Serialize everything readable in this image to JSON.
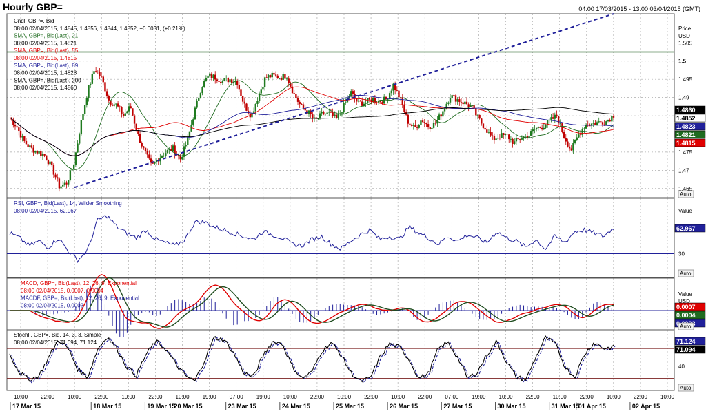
{
  "header": {
    "title": "Hourly GBP=",
    "range": "04:00 17/03/2015 - 13:00 03/04/2015 (GMT)"
  },
  "panels": {
    "price": {
      "unit_title": "Price",
      "unit_sub": "USD",
      "auto": "Auto",
      "legend": [
        {
          "text": "Cndl, GBP=, Bid",
          "color": "#000000"
        },
        {
          "text": "08:00 02/04/2015, 1.4845, 1.4856, 1.4844, 1.4852, +0.0031, (+0.21%)",
          "color": "#000000"
        },
        {
          "text": "SMA, GBP=, Bid(Last),  21",
          "color": "#1f6b1f"
        },
        {
          "text": "08:00 02/04/2015, 1.4821",
          "color": "#000000"
        },
        {
          "text": "SMA, GBP=, Bid(Last),  55",
          "color": "#e00000"
        },
        {
          "text": "08:00 02/04/2015, 1.4815",
          "color": "#e00000"
        },
        {
          "text": "SMA, GBP=, Bid(Last),  89",
          "color": "#20209a"
        },
        {
          "text": "08:00 02/04/2015, 1.4823",
          "color": "#000000"
        },
        {
          "text": "SMA, GBP=, Bid(Last),  200",
          "color": "#000000"
        },
        {
          "text": "08:00 02/04/2015, 1.4860",
          "color": "#000000"
        }
      ],
      "ticks": [
        "1.505",
        "1.5",
        "1.495",
        "1.49",
        "1.485",
        "1.48",
        "1.475",
        "1.47",
        "1.465"
      ],
      "tags": [
        {
          "text": "1.4860",
          "bg": "#000000",
          "fg": "#ffffff"
        },
        {
          "text": "1.4852",
          "bg": "#ffffff",
          "fg": "#000000"
        },
        {
          "text": "1.4823",
          "bg": "#20209a",
          "fg": "#ffffff"
        },
        {
          "text": "1.4821",
          "bg": "#1f6b1f",
          "fg": "#ffffff"
        },
        {
          "text": "1.4815",
          "bg": "#e00000",
          "fg": "#ffffff"
        }
      ]
    },
    "rsi": {
      "unit_title": "Value",
      "auto": "Auto",
      "legend": [
        {
          "text": "RSI, GBP=, Bid(Last),  14,  Wilder Smoothing",
          "color": "#20209a"
        },
        {
          "text": "08:00 02/04/2015, 62.967",
          "color": "#20209a"
        }
      ],
      "ticks": [
        "30"
      ],
      "tags": [
        {
          "text": "62.967",
          "bg": "#20209a",
          "fg": "#ffffff"
        }
      ]
    },
    "macd": {
      "unit_title": "Value",
      "unit_sub": "USD",
      "auto": "Auto",
      "legend": [
        {
          "text": "MACD, GBP=, Bid(Last),  12, 26, 9, Exponential",
          "color": "#e00000"
        },
        {
          "text": "08:00 02/04/2015, 0.0007, 0.0004",
          "color": "#e00000"
        },
        {
          "text": "MACDF, GBP=, Bid(Last),  12, 26, 9, Exponential",
          "color": "#20209a"
        },
        {
          "text": "08:00 02/04/2015, 0.0003",
          "color": "#20209a"
        }
      ],
      "tags": [
        {
          "text": "0.0007",
          "bg": "#e00000",
          "fg": "#ffffff"
        },
        {
          "text": "0.0004",
          "bg": "#1f6b1f",
          "fg": "#ffffff"
        },
        {
          "text": "0.0003",
          "bg": "#20209a",
          "fg": "#ffffff"
        }
      ]
    },
    "stoch": {
      "auto": "Auto",
      "legend": [
        {
          "text": "StochF, GBP=, Bid,  14, 3, 3, Simple",
          "color": "#000000"
        },
        {
          "text": "08:00 02/04/2015, 71.094, 71.124",
          "color": "#000000"
        }
      ],
      "ticks": [
        "40"
      ],
      "tags": [
        {
          "text": "71.124",
          "bg": "#20209a",
          "fg": "#ffffff"
        },
        {
          "text": "71.094",
          "bg": "#000000",
          "fg": "#ffffff"
        }
      ]
    }
  },
  "x_axis": {
    "time_labels": [
      "10:00",
      "22:00",
      "10:00",
      "22:00",
      "10:00",
      "22:00",
      "10:00",
      "19:00",
      "07:00",
      "19:00",
      "10:00",
      "22:00",
      "10:00",
      "22:00",
      "10:00",
      "22:00",
      "07:00",
      "19:00",
      "10:00",
      "22:00",
      "10:00",
      "22:00",
      "10:00",
      "22:00",
      "10:00"
    ],
    "date_labels": [
      "17 Mar 15",
      "18 Mar 15",
      "19 Mar 15",
      "20 Mar 15",
      "23 Mar 15",
      "24 Mar 15",
      "25 Mar 15",
      "26 Mar 15",
      "27 Mar 15",
      "30 Mar 15",
      "31 Mar 15",
      "01 Apr 15",
      "02 Apr 15"
    ]
  },
  "colors": {
    "up": "#1f7a1f",
    "down": "#c00000",
    "sma21": "#1f6b1f",
    "sma55": "#e00000",
    "sma89": "#20209a",
    "sma200": "#000000",
    "rsi": "#20209a",
    "macd": "#e00000",
    "macd_signal": "#1f4d1f",
    "macd_hist": "#20209a",
    "stoch_k": "#000000",
    "stoch_d": "#20209a",
    "trend": "#20209a",
    "hline": "#1f5a1f"
  },
  "chart_data": [
    {
      "type": "candlestick",
      "title": "Hourly GBP=",
      "ylabel": "Price USD",
      "ylim": [
        1.4625,
        1.513
      ],
      "reference_line": 1.5025,
      "trendline": [
        {
          "date": "18 Mar 15 04:00",
          "value": 1.4653
        },
        {
          "date": "03 Apr 15 13:00",
          "value": 1.513
        }
      ],
      "last_candle": {
        "time": "08:00 02/04/2015",
        "open": 1.4845,
        "high": 1.4856,
        "low": 1.4844,
        "close": 1.4852,
        "change": 0.0031,
        "change_pct": 0.21
      },
      "price_path": [
        {
          "date": "17 Mar 15",
          "values": [
            1.4845,
            1.482,
            1.478,
            1.476,
            1.475
          ]
        },
        {
          "date": "18 Mar 15",
          "values": [
            1.474,
            1.4705,
            1.4655,
            1.4665,
            1.4715,
            1.4825,
            1.492,
            1.498,
            1.495,
            1.489
          ]
        },
        {
          "date": "19 Mar 15",
          "values": [
            1.488,
            1.485,
            1.4875,
            1.48,
            1.475,
            1.471,
            1.4735,
            1.475
          ]
        },
        {
          "date": "20 Mar 15",
          "values": [
            1.476,
            1.473,
            1.478,
            1.486,
            1.493,
            1.496,
            1.4955,
            1.4945
          ]
        },
        {
          "date": "23 Mar 15",
          "values": [
            1.495,
            1.4945,
            1.488,
            1.485,
            1.4905,
            1.4955,
            1.496,
            1.4955
          ]
        },
        {
          "date": "24 Mar 15",
          "values": [
            1.496,
            1.491,
            1.4875,
            1.486,
            1.4835,
            1.4855
          ]
        },
        {
          "date": "25 Mar 15",
          "values": [
            1.4855,
            1.484,
            1.4875,
            1.4915,
            1.4885,
            1.4885,
            1.4895
          ]
        },
        {
          "date": "26 Mar 15",
          "values": [
            1.489,
            1.4895,
            1.4935,
            1.4895,
            1.4835,
            1.4815,
            1.484,
            1.482
          ]
        },
        {
          "date": "27 Mar 15",
          "values": [
            1.483,
            1.4865,
            1.4905,
            1.4895,
            1.4885
          ]
        },
        {
          "date": "30 Mar 15",
          "values": [
            1.4875,
            1.484,
            1.4815,
            1.4785,
            1.4795,
            1.4795,
            1.4775,
            1.479
          ]
        },
        {
          "date": "31 Mar 15",
          "values": [
            1.4795,
            1.4815,
            1.482,
            1.4835,
            1.485,
            1.4795,
            1.4755
          ]
        },
        {
          "date": "01 Apr 15",
          "values": [
            1.4795,
            1.4825,
            1.4828,
            1.4832
          ]
        },
        {
          "date": "02 Apr 15",
          "values": [
            1.4835,
            1.4852
          ]
        }
      ],
      "sma": [
        {
          "name": "SMA 21",
          "last": 1.4821
        },
        {
          "name": "SMA 55",
          "last": 1.4815
        },
        {
          "name": "SMA 89",
          "last": 1.4823
        },
        {
          "name": "SMA 200",
          "last": 1.486
        }
      ]
    },
    {
      "type": "line",
      "title": "RSI, GBP=, Bid(Last), 14, Wilder Smoothing",
      "last": 62.967,
      "levels": [
        70,
        30
      ],
      "values": [
        56,
        50,
        40,
        46,
        38,
        50,
        34,
        22,
        34,
        72,
        78,
        64,
        56,
        50,
        60,
        48,
        44,
        40,
        48,
        70,
        70,
        64,
        60,
        56,
        52,
        48,
        58,
        54,
        50,
        42,
        40,
        48,
        52,
        42,
        36,
        46,
        54,
        60,
        48,
        52,
        48,
        64,
        56,
        50,
        42,
        52,
        46,
        54,
        50,
        44,
        58,
        50,
        46,
        38,
        48,
        36,
        52,
        44,
        58,
        60,
        56,
        52,
        63
      ]
    },
    {
      "type": "line",
      "title": "MACD, GBP=, Bid(Last), 12, 26, 9, Exponential",
      "series": [
        {
          "name": "MACD",
          "last": 0.0007
        },
        {
          "name": "Signal",
          "last": 0.0004
        },
        {
          "name": "MACDF",
          "last": 0.0003
        }
      ]
    },
    {
      "type": "line",
      "title": "StochF, GBP=, Bid, 14, 3, 3, Simple",
      "levels": [
        70,
        30
      ],
      "series": [
        {
          "name": "%K",
          "last": 71.094
        },
        {
          "name": "%D",
          "last": 71.124
        }
      ],
      "values": [
        60,
        30,
        18,
        24,
        55,
        85,
        70,
        35,
        22,
        68,
        90,
        70,
        40,
        25,
        60,
        82,
        70,
        45,
        25,
        15,
        50,
        88,
        85,
        62,
        30,
        22,
        58,
        82,
        78,
        40,
        20,
        30,
        65,
        80,
        60,
        30,
        15,
        20,
        55,
        78,
        72,
        52,
        20,
        28,
        70,
        80,
        55,
        20,
        30,
        60,
        82,
        48,
        22,
        18,
        55,
        88,
        78,
        40,
        22,
        60,
        80,
        70,
        72
      ]
    }
  ]
}
